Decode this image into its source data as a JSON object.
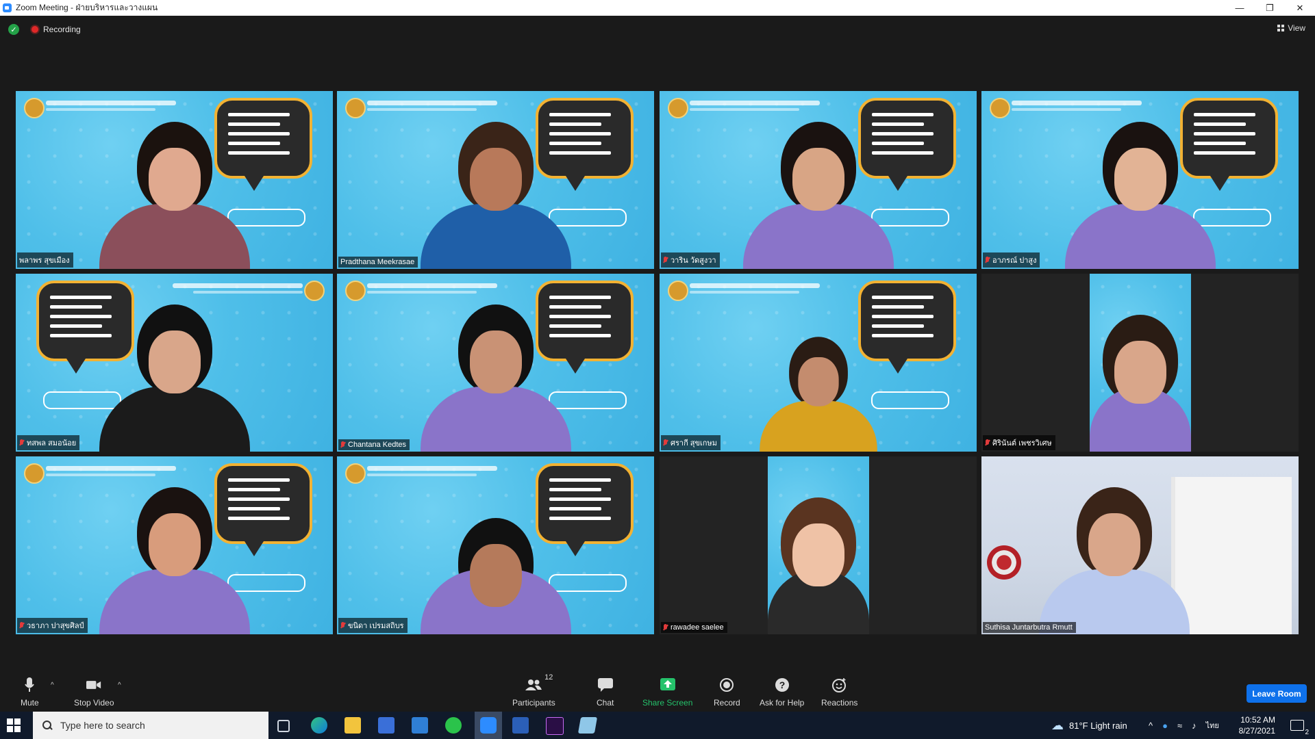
{
  "window": {
    "title": "Zoom Meeting - ฝ่ายบริหารและวางแผน",
    "controls": [
      "minimize-icon",
      "restore-icon",
      "close-icon"
    ]
  },
  "status": {
    "recording_label": "Recording",
    "view_label": "View"
  },
  "participants": [
    {
      "name": "พลาพร สุขเมือง",
      "muted": false,
      "active": false
    },
    {
      "name": "Pradthana Meekrasae",
      "muted": false,
      "active": true
    },
    {
      "name": "วาริน วัดสูงวา",
      "muted": true,
      "active": false
    },
    {
      "name": "อาภรณ์ ปาสูง",
      "muted": true,
      "active": false
    },
    {
      "name": "ทสพล สมอน้อย",
      "muted": true,
      "active": false
    },
    {
      "name": "Chantana Kedtes",
      "muted": true,
      "active": false
    },
    {
      "name": "ศรากี  สุขเกษม",
      "muted": true,
      "active": false
    },
    {
      "name": "ศิรินันต์ เพชรวิเศษ",
      "muted": true,
      "active": false
    },
    {
      "name": "วธาภา ปาสุขศิลป์",
      "muted": true,
      "active": false
    },
    {
      "name": "ขนิดา เปรมสถิบร",
      "muted": true,
      "active": false
    },
    {
      "name": "rawadee saelee",
      "muted": true,
      "active": false
    },
    {
      "name": "Suthisa  Juntarbutra Rmutt",
      "muted": false,
      "active": false
    }
  ],
  "toolbar": {
    "mute": "Mute",
    "stop_video": "Stop Video",
    "participants": "Participants",
    "participants_count": "12",
    "chat": "Chat",
    "share_screen": "Share Screen",
    "record": "Record",
    "ask_for_help": "Ask for Help",
    "reactions": "Reactions",
    "leave_room": "Leave Room"
  },
  "taskbar": {
    "search_placeholder": "Type here to search",
    "weather": "81°F  Light rain",
    "language": "ไทย",
    "time": "10:52 AM",
    "date": "8/27/2021",
    "notification_count": "2"
  },
  "colors": {
    "active_speaker_border": "#d7e23a",
    "share_screen_green": "#25c26b",
    "leave_room_blue": "#0e71eb"
  }
}
